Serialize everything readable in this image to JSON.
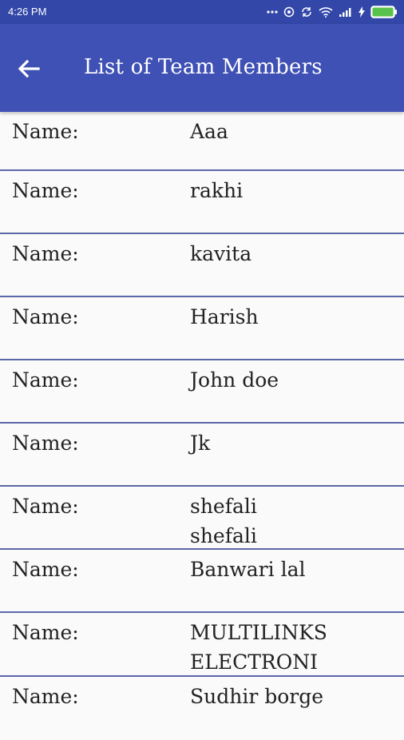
{
  "status_bar": {
    "time": "4:26 PM",
    "icons": [
      "more-dots-icon",
      "data-saver-icon",
      "sync-icon",
      "wifi-icon",
      "signal-icon",
      "charging-icon",
      "battery-icon"
    ]
  },
  "app_bar": {
    "title": "List of Team Members",
    "back_icon": "arrow-back-icon",
    "color": "#3f51b5"
  },
  "members": [
    {
      "label": "Name:",
      "value": "Aaa"
    },
    {
      "label": "Name:",
      "value": "rakhi"
    },
    {
      "label": "Name:",
      "value": "kavita"
    },
    {
      "label": "Name:",
      "value": "Harish"
    },
    {
      "label": "Name:",
      "value": "John doe"
    },
    {
      "label": "Name:",
      "value": "Jk"
    },
    {
      "label": "Name:",
      "value": "shefali\nshefali"
    },
    {
      "label": "Name:",
      "value": "Banwari lal"
    },
    {
      "label": "Name:",
      "value": "MULTILINKS\nELECTRONI"
    },
    {
      "label": "Name:",
      "value": "Sudhir borge"
    }
  ]
}
